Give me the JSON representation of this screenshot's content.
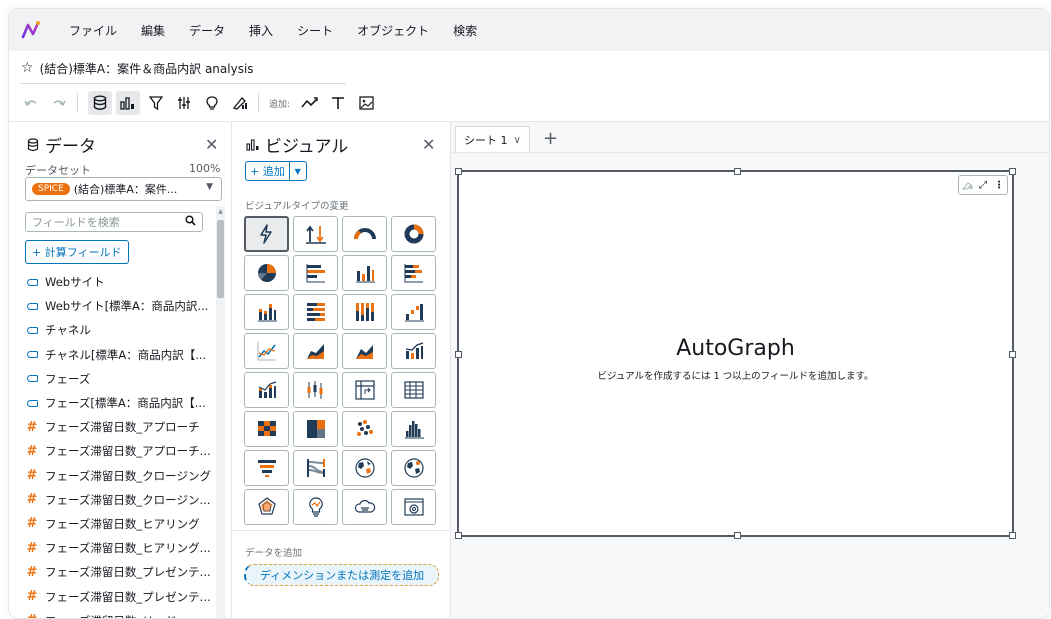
{
  "menubar": {
    "items": [
      "ファイル",
      "編集",
      "データ",
      "挿入",
      "シート",
      "オブジェクト",
      "検索"
    ]
  },
  "analysis": {
    "title": "(結合)標準A：案件＆商品内訳 analysis"
  },
  "toolbar": {
    "add_label": "追加:"
  },
  "data_panel": {
    "title": "データ",
    "dataset_label": "データセット",
    "dataset_percent": "100%",
    "spice_badge": "SPICE",
    "dataset_name": "(結合)標準A：案件...",
    "search_placeholder": "フィールドを検索",
    "calc_field_button": "+ 計算フィールド",
    "fields": [
      {
        "type": "dimension",
        "label": "Webサイト"
      },
      {
        "type": "dimension",
        "label": "Webサイト[標準A：商品内訳..."
      },
      {
        "type": "dimension",
        "label": "チャネル"
      },
      {
        "type": "dimension",
        "label": "チャネル[標準A：商品内訳【..."
      },
      {
        "type": "dimension",
        "label": "フェーズ"
      },
      {
        "type": "dimension",
        "label": "フェーズ[標準A：商品内訳【..."
      },
      {
        "type": "measure",
        "label": "フェーズ滞留日数_アプローチ"
      },
      {
        "type": "measure",
        "label": "フェーズ滞留日数_アプローチ..."
      },
      {
        "type": "measure",
        "label": "フェーズ滞留日数_クロージング"
      },
      {
        "type": "measure",
        "label": "フェーズ滞留日数_クロージン..."
      },
      {
        "type": "measure",
        "label": "フェーズ滞留日数_ヒアリング"
      },
      {
        "type": "measure",
        "label": "フェーズ滞留日数_ヒアリング..."
      },
      {
        "type": "measure",
        "label": "フェーズ滞留日数_プレゼンテ..."
      },
      {
        "type": "measure",
        "label": "フェーズ滞留日数_プレゼンテ..."
      },
      {
        "type": "measure",
        "label": "フェーズ滞留日数_リード"
      }
    ]
  },
  "visual_panel": {
    "title": "ビジュアル",
    "add_button": "+ 追加",
    "visual_types_label": "ビジュアルタイプの変更",
    "visual_types": [
      "autograph-icon",
      "kpi-icon",
      "gauge-icon",
      "donut-icon",
      "pie-icon",
      "horizontal-bar-icon",
      "vertical-bar-icon",
      "stacked-horizontal-bar-icon",
      "stacked-vertical-bar-icon",
      "horizontal-100-bar-icon",
      "vertical-100-bar-icon",
      "waterfall-icon",
      "line-icon",
      "area-icon",
      "stacked-area-icon",
      "combo-bar-line-icon",
      "combo-stacked-line-icon",
      "box-plot-icon",
      "pivot-table-icon",
      "table-icon",
      "heat-map-icon",
      "tree-map-icon",
      "scatter-icon",
      "histogram-icon",
      "funnel-icon",
      "sankey-icon",
      "filled-map-icon",
      "points-map-icon",
      "radar-icon",
      "insight-icon",
      "word-cloud-icon",
      "custom-visual-icon"
    ],
    "add_data_label": "データを追加",
    "dropzone_text": "ディメンションまたは測定を追加"
  },
  "sheets": {
    "active": "シート 1"
  },
  "visual": {
    "title": "AutoGraph",
    "subtitle": "ビジュアルを作成するには 1 つ以上のフィールドを追加します。"
  },
  "colors": {
    "accent": "#0073bb",
    "orange": "#ec7211",
    "navy": "#1f3b57",
    "purple": "#7b3fe4"
  }
}
